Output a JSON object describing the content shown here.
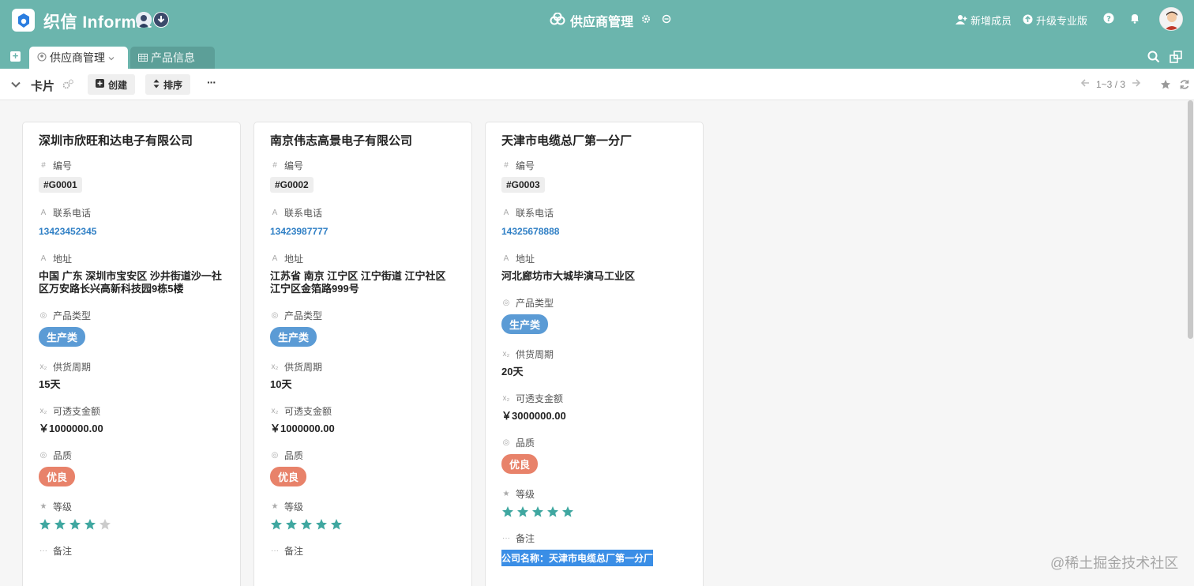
{
  "header": {
    "brand": "织信 Informat",
    "app_title": "供应商管理",
    "add_member": "新增成员",
    "upgrade": "升级专业版"
  },
  "tabs": [
    {
      "label": "供应商管理",
      "active": true
    },
    {
      "label": "产品信息",
      "active": false
    }
  ],
  "toolbar": {
    "view_name": "卡片",
    "create_label": "创建",
    "sort_label": "排序",
    "more_label": "···",
    "pager_text": "1~3 / 3"
  },
  "field_labels": {
    "code": "编号",
    "phone": "联系电话",
    "address": "地址",
    "product_type": "产品类型",
    "lead_time": "供货周期",
    "credit": "可透支金额",
    "quality": "品质",
    "level": "等级",
    "note": "备注"
  },
  "cards": [
    {
      "title": "深圳市欣旺和达电子有限公司",
      "code": "#G0001",
      "phone": "13423452345",
      "address": "中国 广东 深圳市宝安区 沙井街道沙一社区万安路长兴高新科技园9栋5楼",
      "product_type": "生产类",
      "lead_time": "15天",
      "credit": "￥1000000.00",
      "quality": "优良",
      "rating": 4,
      "note": ""
    },
    {
      "title": "南京伟志高景电子有限公司",
      "code": "#G0002",
      "phone": "13423987777",
      "address": "江苏省 南京 江宁区 江宁街道 江宁社区 江宁区金箔路999号",
      "product_type": "生产类",
      "lead_time": "10天",
      "credit": "￥1000000.00",
      "quality": "优良",
      "rating": 5,
      "note": ""
    },
    {
      "title": "天津市电缆总厂第一分厂",
      "code": "#G0003",
      "phone": "14325678888",
      "address": "河北廊坊市大城毕演马工业区",
      "product_type": "生产类",
      "lead_time": "20天",
      "credit": "￥3000000.00",
      "quality": "优良",
      "rating": 5,
      "note": "公司名称：天津市电缆总厂第一分厂"
    }
  ],
  "watermark": "@稀土掘金技术社区",
  "colors": {
    "header_bg": "#6bb5ad",
    "tab_inactive_bg": "#5c9f98",
    "tag_production": "#5b9bd5",
    "tag_quality": "#e8826a",
    "star_on": "#3fa7a0",
    "star_off": "#cccccc",
    "phone": "#2f7fc5"
  },
  "icons": {
    "logo": "logo-icon",
    "header_avatar_a": "avatar-icon",
    "header_avatar_b": "download-circle-icon",
    "app": "cloud-cluster-icon",
    "app_settings": "gear-icon",
    "app_info": "circle-dot-icon",
    "add_member": "add-user-icon",
    "upgrade": "arrow-up-circle-icon",
    "help": "question-icon",
    "notifications": "bell-icon",
    "search": "search-icon",
    "switch_window": "window-switch-icon",
    "card_view": "chevron-down-icon",
    "view_settings": "gears-icon",
    "prev_page": "arrow-left-icon",
    "next_page": "arrow-right-icon",
    "favorite": "star-icon",
    "refresh": "refresh-icon"
  }
}
